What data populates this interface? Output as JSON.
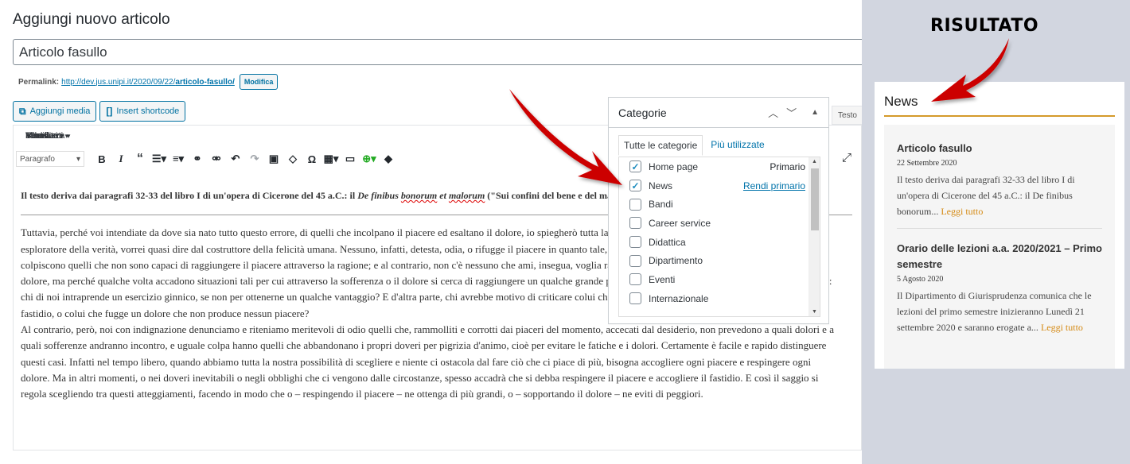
{
  "editor": {
    "heading": "Aggiungi nuovo articolo",
    "title_value": "Articolo fasullo",
    "permalink_label": "Permalink:",
    "permalink_base": "http://dev.jus.unipi.it/2020/09/22/",
    "permalink_slug": "articolo-fasullo/",
    "modifica_label": "Modifica",
    "add_media_label": "Aggiungi media",
    "insert_shortcode_label": "Insert shortcode",
    "text_tab_label": "Testo",
    "menu": [
      "File",
      "Modifica",
      "Visualizza",
      "Inserisci",
      "Formato",
      "Strumenti",
      "Tabella"
    ],
    "format_select": "Paragrafo",
    "content": {
      "lead_start": "Il testo deriva dai paragrafi 32-33 del libro I di un'opera di Cicerone del 45 a.C.: il ",
      "lead_italic_1": "De finibus ",
      "lead_italic_2": "bonorum",
      "lead_mid": " et ",
      "lead_italic_3": "malorum",
      "lead_end": " (\"Sui confini del bene e del male\")",
      "p1_lines": [
        "Tuttavia, perché voi intendiate da dove sia nato tutto questo errore, di quelli che incolpano il piacere ed esaltano il dolore, io spiegherò tutta la questione, e presenterò le idee espresse dal famoso",
        "esploratore della verità, vorrei quasi dire dal costruttore della felicità umana. Nessuno, infatti, detesta, odia, o rifugge il piacere in quanto tale, ma perché grandi sofferenze",
        "colpiscono quelli che non sono capaci di raggiungere il piacere attraverso la ragione; e al contrario, non c'è nessuno che ami, insegua, voglia raggiungere il dolore in se stesso, soltanto perché è",
        "dolore, ma perché qualche volta accadono situazioni tali per cui attraverso la sofferenza o il dolore si cerca di raggiungere un qualche grande piacere. Concentrandoci su casi di piccola importanza:",
        "chi di noi intraprende un esercizio ginnico, se non per ottenerne un qualche vantaggio? E d'altra parte, chi avrebbe motivo di criticare colui che desidera provare un piacere cui non segua nessun",
        "fastidio, o colui che fugge un dolore che non produce nessun piacere?"
      ],
      "p2_lines": [
        "Al contrario, però, noi con indignazione denunciamo e riteniamo meritevoli di odio quelli che, rammolliti e corrotti dai piaceri del momento, accecati dal desiderio, non prevedono a quali dolori e a",
        "quali sofferenze andranno incontro, e uguale colpa hanno quelli che abbandonano i propri doveri per pigrizia d'animo, cioè per evitare le fatiche e i dolori. Certamente è facile e rapido distinguere",
        "questi casi. Infatti nel tempo libero, quando abbiamo tutta la nostra possibilità di scegliere e niente ci ostacola dal fare ciò che ci piace di più, bisogna accogliere ogni piacere e respingere ogni",
        "dolore. Ma in altri momenti, o nei doveri inevitabili o negli obblighi che ci vengono dalle circostanze, spesso accadrà che si debba respingere il piacere e accogliere il fastidio. E così il saggio si",
        "regola scegliendo tra questi atteggiamenti, facendo in modo che o – respingendo il piacere – ne ottenga di più grandi, o – sopportando il dolore – ne eviti di peggiori."
      ]
    }
  },
  "categories_panel": {
    "title": "Categorie",
    "tabs": [
      "Tutte le categorie",
      "Più utilizzate"
    ],
    "items": [
      {
        "label": "Home page",
        "checked": true,
        "right": "Primario",
        "right_type": "plain"
      },
      {
        "label": "News",
        "checked": true,
        "right": "Rendi primario",
        "right_type": "link"
      },
      {
        "label": "Bandi",
        "checked": false
      },
      {
        "label": "Career service",
        "checked": false
      },
      {
        "label": "Didattica",
        "checked": false
      },
      {
        "label": "Dipartimento",
        "checked": false
      },
      {
        "label": "Eventi",
        "checked": false
      },
      {
        "label": "Internazionale",
        "checked": false
      }
    ]
  },
  "result": {
    "annotation": "RISULTATO",
    "widget_title": "News",
    "items": [
      {
        "title": "Articolo fasullo",
        "date": "22 Settembre 2020",
        "excerpt": "Il testo deriva dai paragrafi 32-33 del libro I di un'opera di Cicerone del 45 a.C.: il De finibus bonorum... ",
        "more": "Leggi tutto"
      },
      {
        "title": "Orario delle lezioni a.a. 2020/2021 – Primo semestre",
        "date": "5 Agosto 2020",
        "excerpt": "Il Dipartimento di Giurisprudenza comunica che le lezioni del primo semestre inizieranno Lunedì 21 settembre 2020 e saranno erogate a... ",
        "more": "Leggi tutto"
      }
    ]
  },
  "colors": {
    "wp_blue": "#0073aa",
    "accent_orange": "#d59a2a",
    "arrow_red": "#cc0000",
    "side_bg": "#d2d6e0"
  }
}
